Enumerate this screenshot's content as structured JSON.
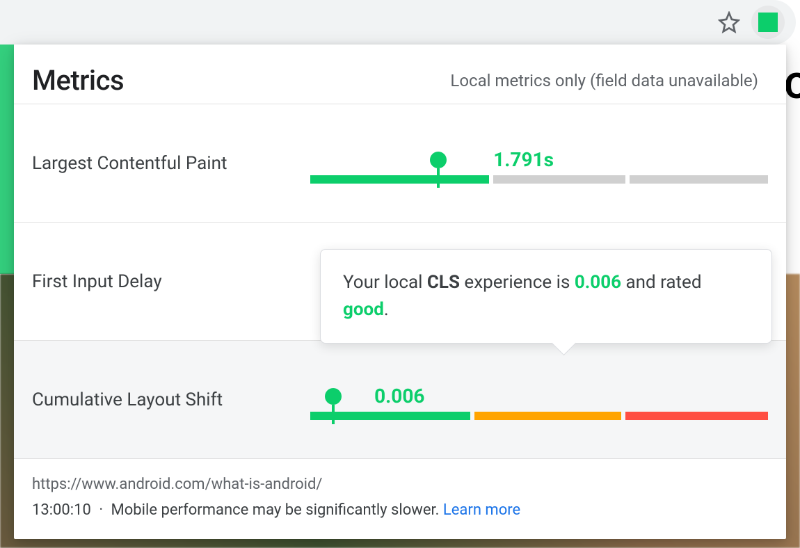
{
  "header": {
    "title": "Metrics",
    "subtitle": "Local metrics only (field data unavailable)"
  },
  "metrics": {
    "lcp": {
      "label": "Largest Contentful Paint",
      "value_display": "1.791s",
      "marker_pct": 28,
      "value_left_pct": 40,
      "segments": {
        "good_fill_pct": 40,
        "rest": "grey"
      }
    },
    "fid": {
      "label": "First Input Delay"
    },
    "cls": {
      "label": "Cumulative Layout Shift",
      "value_display": "0.006",
      "marker_pct": 5,
      "value_left_pct": 14
    }
  },
  "tooltip": {
    "prefix": "Your local ",
    "metric_abbr": "CLS",
    "mid": " experience is ",
    "value": "0.006",
    "mid2": " and rated ",
    "rating": "good",
    "suffix": "."
  },
  "footer": {
    "url": "https://www.android.com/what-is-android/",
    "time": "13:00:10",
    "warning": "Mobile performance may be significantly slower.",
    "learn_more": "Learn more"
  },
  "colors": {
    "good": "#0cce6b",
    "needs_improvement": "#ffa400",
    "poor": "#ff4e42",
    "grey": "#d0d0d0",
    "link": "#1a73e8"
  }
}
